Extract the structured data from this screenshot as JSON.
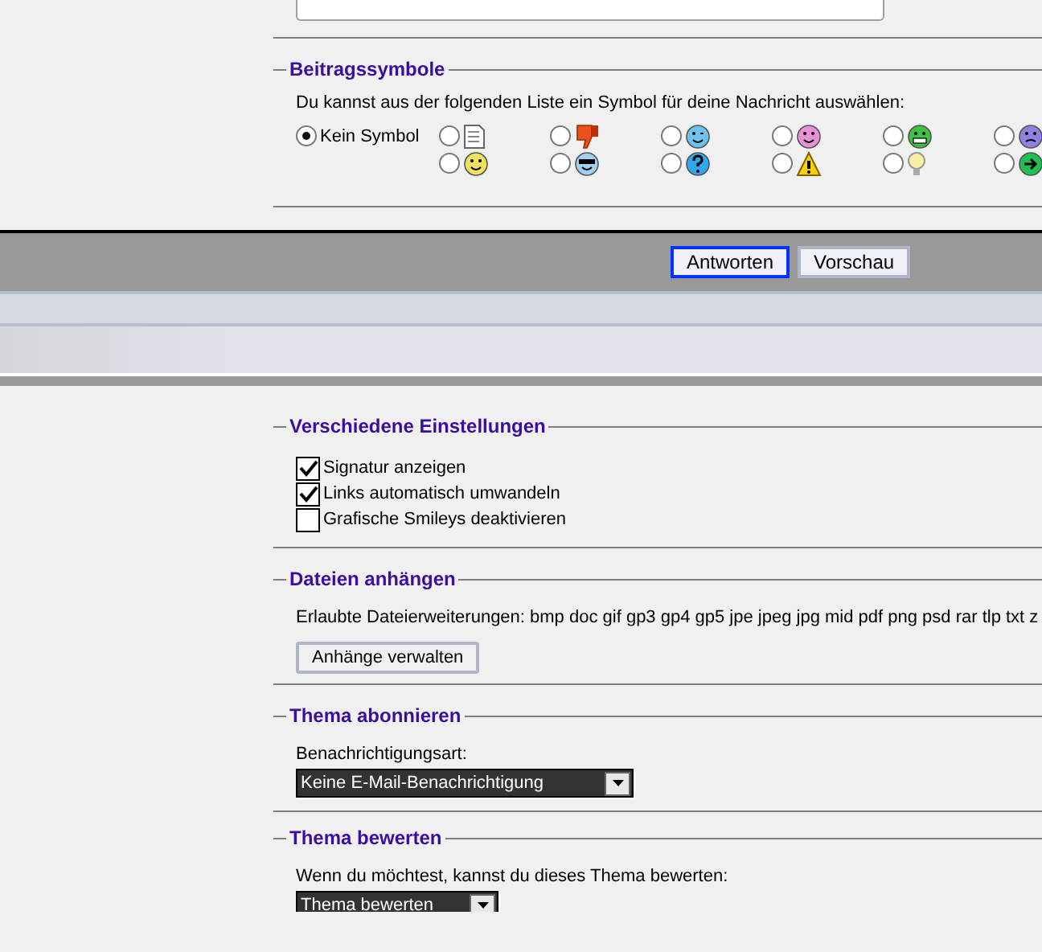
{
  "post_icons": {
    "legend": "Beitragssymbole",
    "hint": "Du kannst aus der folgenden Liste ein Symbol für deine Nachricht auswählen:",
    "none_label": "Kein Symbol",
    "none_selected": true,
    "icons": [
      {
        "selected": false
      },
      {
        "selected": false
      },
      {
        "selected": false
      },
      {
        "selected": false
      },
      {
        "selected": false
      },
      {
        "selected": false
      },
      {
        "selected": false
      },
      {
        "selected": false
      },
      {
        "selected": false
      },
      {
        "selected": false
      },
      {
        "selected": false
      },
      {
        "selected": false
      }
    ]
  },
  "buttons": [
    {
      "label": "Antworten",
      "focused": true
    },
    {
      "label": "Vorschau",
      "focused": false
    }
  ],
  "misc_settings": {
    "legend": "Verschiedene Einstellungen",
    "options": [
      {
        "label": "Signatur anzeigen",
        "checked": true
      },
      {
        "label": "Links automatisch umwandeln",
        "checked": true
      },
      {
        "label": "Grafische Smileys deaktivieren",
        "checked": false
      }
    ]
  },
  "attachments": {
    "legend": "Dateien anhängen",
    "allowed": "Erlaubte Dateierweiterungen: bmp doc gif gp3 gp4 gp5 jpe jpeg jpg mid pdf png psd rar tlp txt z",
    "button": "Anhänge verwalten"
  },
  "subscribe": {
    "legend": "Thema abonnieren",
    "label": "Benachrichtigungsart:",
    "value": "Keine E-Mail-Benachrichtigung"
  },
  "rate": {
    "legend": "Thema bewerten",
    "label": "Wenn du möchtest, kannst du dieses Thema bewerten:",
    "value": "Thema bewerten"
  }
}
